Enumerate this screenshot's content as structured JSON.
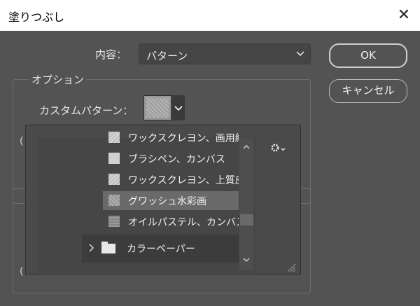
{
  "window": {
    "title": "塗りつぶし",
    "close_glyph": "✕"
  },
  "contents": {
    "label": "内容：",
    "value": "パターン"
  },
  "buttons": {
    "ok": "OK",
    "cancel": "キャンセル"
  },
  "options": {
    "legend": "オプション",
    "custom_pattern_label": "カスタムパターン："
  },
  "picker": {
    "items": [
      {
        "label": "ワックスクレヨン、画用紙"
      },
      {
        "label": "ブラシペン、カンバス"
      },
      {
        "label": "ワックスクレヨン、上質皮"
      },
      {
        "label": "グワッシュ水彩画",
        "selected": true
      },
      {
        "label": "オイルパステル、カンバス"
      }
    ],
    "folder": {
      "label": "カラーペーパー"
    }
  },
  "icons": {
    "close": "close-icon",
    "select_chevron": "chevron-down-icon",
    "pattern_chevron": "chevron-down-icon",
    "settings": "gear-icon",
    "scroll_up": "chevron-up-icon",
    "scroll_down": "chevron-down-icon",
    "expand": "chevron-right-icon",
    "folder": "folder-icon",
    "resize": "resize-grip-icon"
  },
  "colors": {
    "dialog_bg": "#535353",
    "title_bg": "#ffffff",
    "selected_row": "#6a6a6a"
  }
}
